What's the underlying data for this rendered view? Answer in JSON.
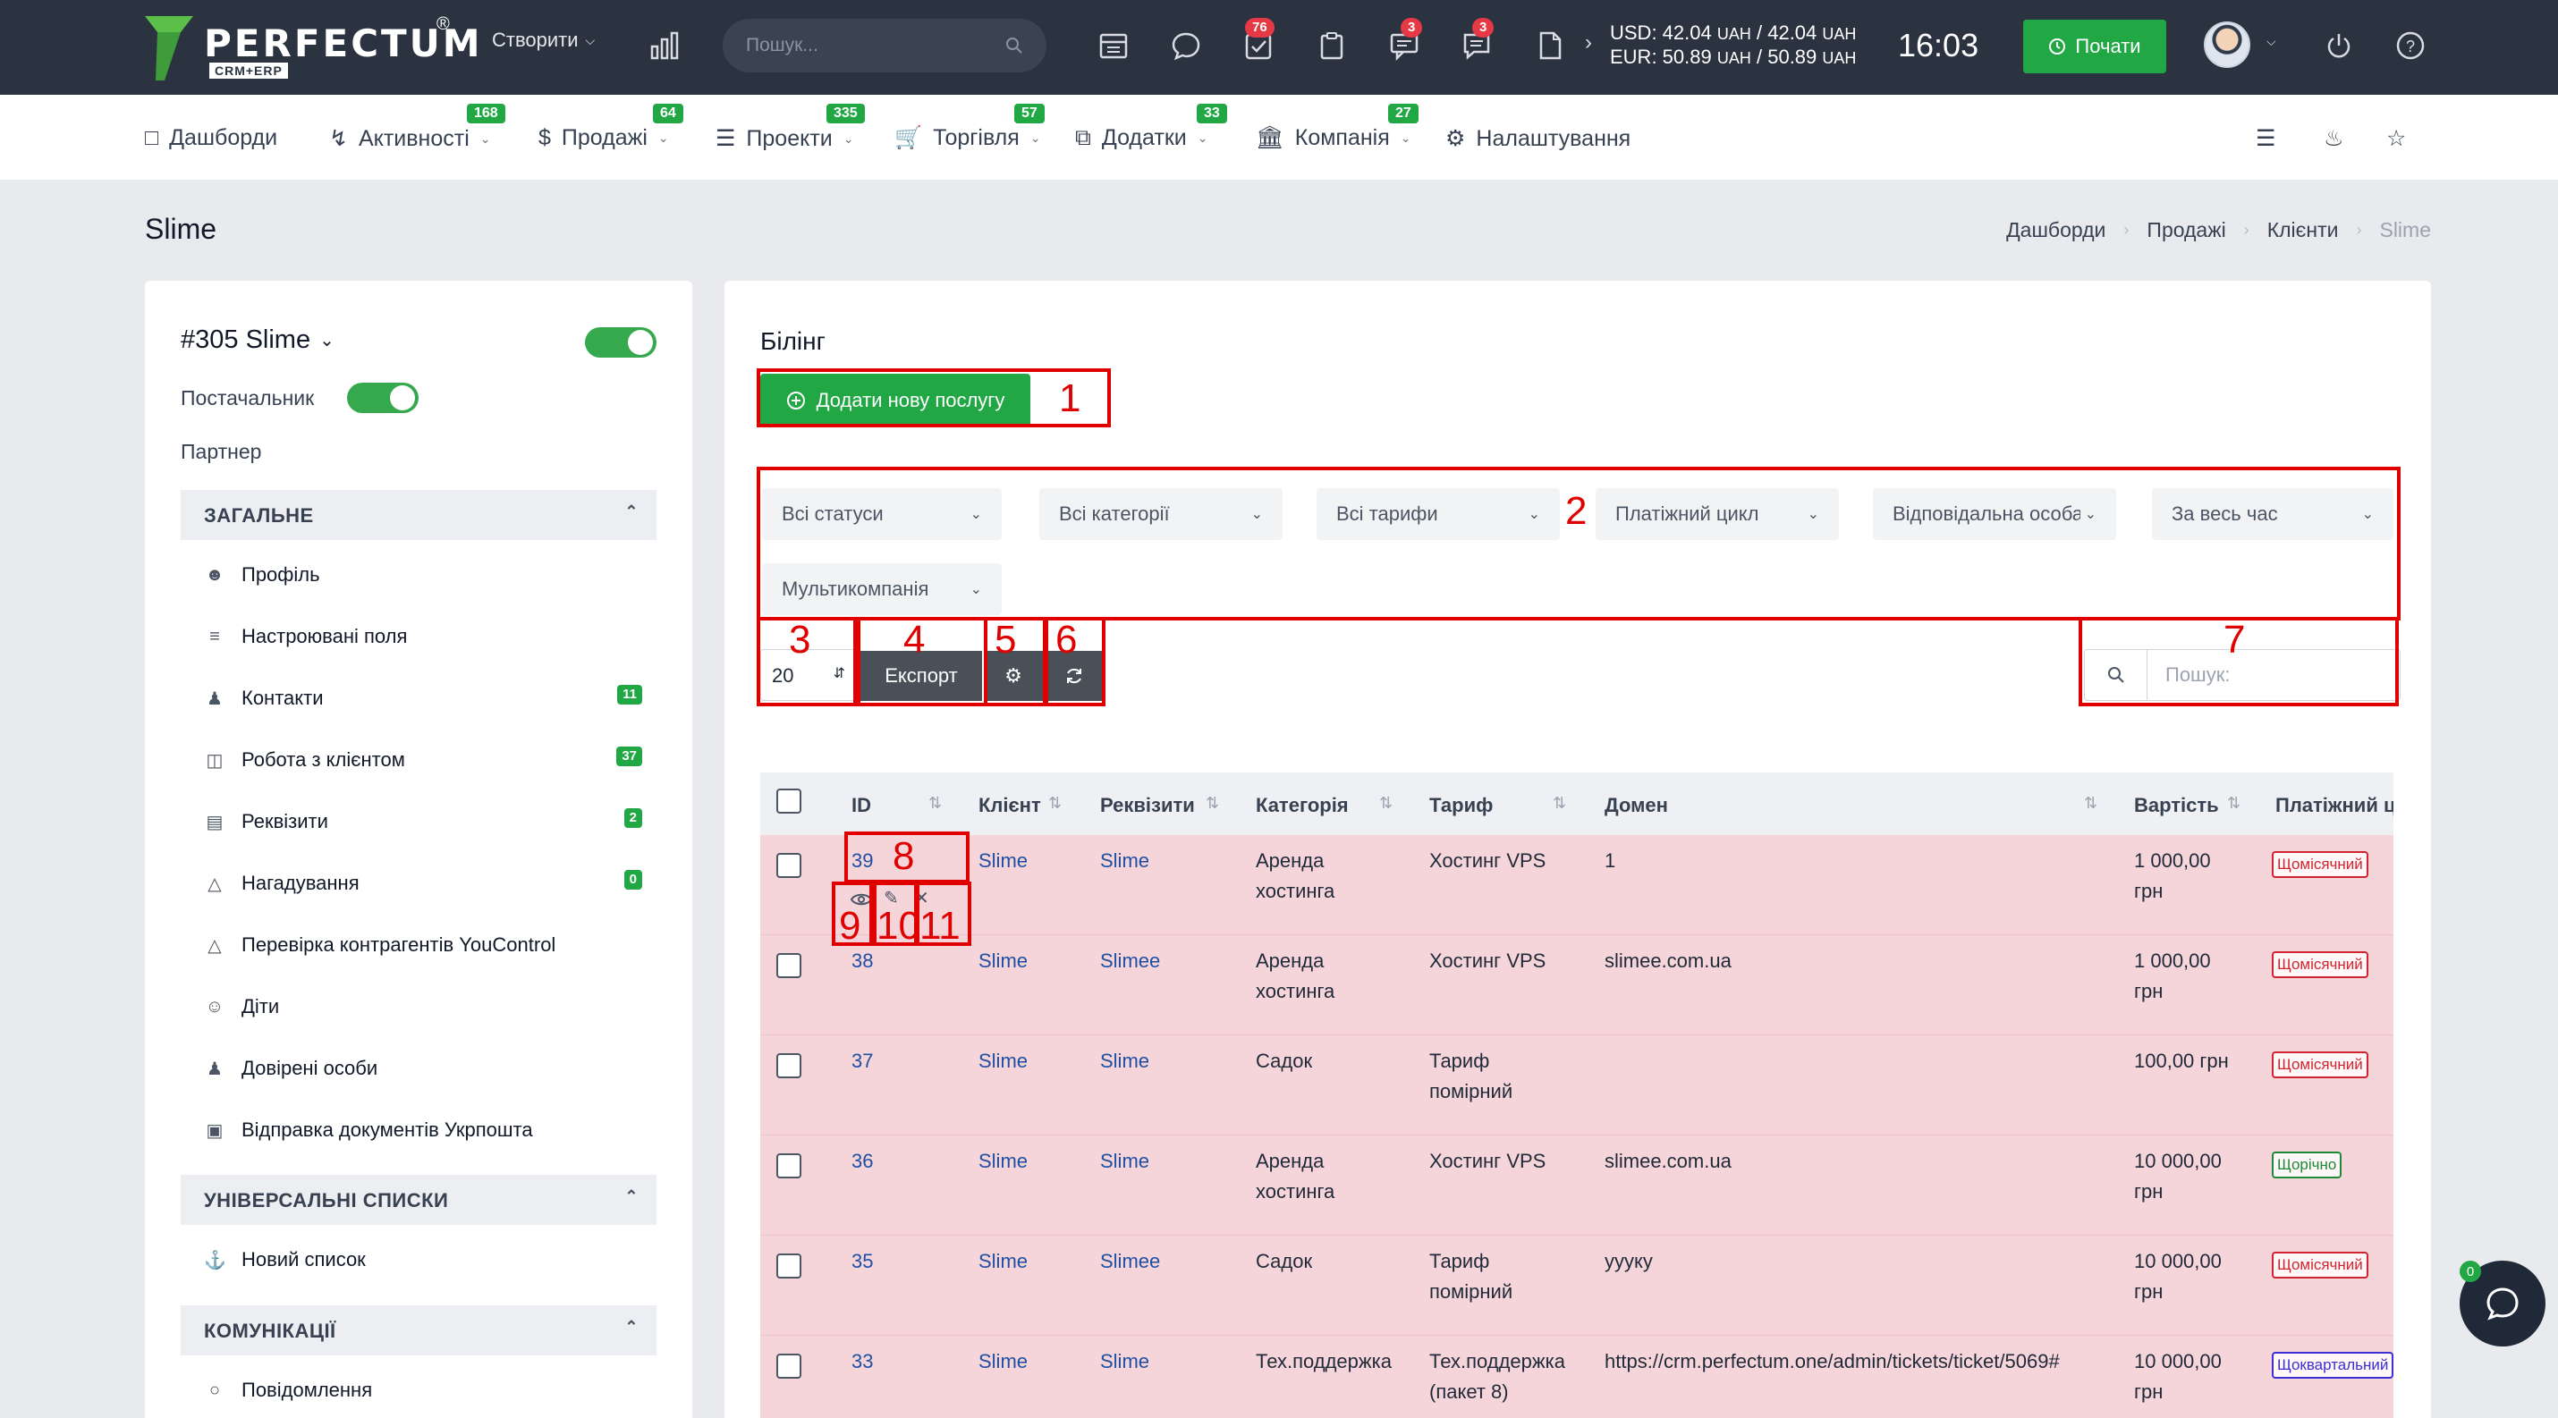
{
  "topbar": {
    "brand": "PERFECTUM",
    "brand_reg": "®",
    "brand_sub": "CRM+ERP",
    "create_label": "Створити",
    "search_placeholder": "Пошук...",
    "badges": {
      "tasks": "76",
      "chat": "3",
      "messages": "3"
    },
    "usd": "USD: 42.04",
    "usd_unit1": "UAH",
    "usd_sep": "/ 42.04",
    "usd_unit2": "UAH",
    "eur": "EUR: 50.89",
    "eur_unit1": "UAH",
    "eur_sep": "/ 50.89",
    "eur_unit2": "UAH",
    "clock": "16:03",
    "start_label": "Почати"
  },
  "nav": [
    {
      "label": "Дашборди",
      "icon": "monitor-icon"
    },
    {
      "label": "Активності",
      "badge": "168",
      "icon": "bolt-icon"
    },
    {
      "label": "Продажі",
      "badge": "64",
      "icon": "dollar-icon"
    },
    {
      "label": "Проекти",
      "badge": "335",
      "icon": "layers-icon"
    },
    {
      "label": "Торгівля",
      "badge": "57",
      "icon": "cart-icon"
    },
    {
      "label": "Додатки",
      "badge": "33",
      "icon": "copy-icon"
    },
    {
      "label": "Компанія",
      "badge": "27",
      "icon": "building-icon"
    },
    {
      "label": "Налаштування",
      "icon": "gear-icon"
    }
  ],
  "page": {
    "title": "Slime",
    "breadcrumb": [
      "Дашборди",
      "Продажі",
      "Клієнти",
      "Slime"
    ]
  },
  "sidebar": {
    "client": "#305 Slime",
    "supplier_label": "Постачальник",
    "partner_label": "Партнер",
    "sections": [
      {
        "title": "ЗАГАЛЬНЕ",
        "items": [
          {
            "label": "Профіль",
            "icon": "user-icon"
          },
          {
            "label": "Настроювані поля",
            "icon": "list-icon"
          },
          {
            "label": "Контакти",
            "icon": "users-icon",
            "badge": "11"
          },
          {
            "label": "Робота з клієнтом",
            "icon": "clipboard-icon",
            "badge": "37"
          },
          {
            "label": "Реквізити",
            "icon": "id-card-icon",
            "badge": "2"
          },
          {
            "label": "Нагадування",
            "icon": "bell-icon",
            "badge": "0"
          },
          {
            "label": "Перевірка контрагентів YouControl",
            "icon": "bell-icon"
          },
          {
            "label": "Діти",
            "icon": "child-icon"
          },
          {
            "label": "Довірені особи",
            "icon": "people-icon"
          },
          {
            "label": "Відправка документів Укрпошта",
            "icon": "boxes-icon"
          }
        ]
      },
      {
        "title": "УНІВЕРСАЛЬНІ СПИСКИ",
        "items": [
          {
            "label": "Новий список",
            "icon": "anchor-icon"
          }
        ]
      },
      {
        "title": "КОМУНІКАЦІЇ",
        "items": [
          {
            "label": "Повідомлення",
            "icon": "chat-icon"
          }
        ]
      }
    ]
  },
  "billing": {
    "title": "Білінг",
    "add_label": "Додати нову послугу",
    "filters": [
      "Всі статуси",
      "Всі категорії",
      "Всі тарифи",
      "Платіжний цикл",
      "Відповідальна особа",
      "За весь час",
      "Мультикомпанія"
    ],
    "per_page": "20",
    "export_label": "Експорт",
    "search_placeholder": "Пошук:",
    "annotations": [
      "1",
      "2",
      "3",
      "4",
      "5",
      "6",
      "7",
      "8",
      "9",
      "10",
      "11"
    ],
    "columns": [
      "ID",
      "Клієнт",
      "Реквізити",
      "Категорія",
      "Тариф",
      "Домен",
      "Вартість",
      "Платіжний цикл"
    ],
    "rows": [
      {
        "id": "39",
        "client": "Slime",
        "req": "Slime",
        "cat1": "Аренда",
        "cat2": "хостинга",
        "tariff1": "Хостинг VPS",
        "tariff2": "",
        "domain": "1",
        "price1": "1 000,00",
        "price2": "грн",
        "cycle": "Щомісячний",
        "cycle_color": "red"
      },
      {
        "id": "38",
        "client": "Slime",
        "req": "Slimee",
        "cat1": "Аренда",
        "cat2": "хостинга",
        "tariff1": "Хостинг VPS",
        "tariff2": "",
        "domain": "slimee.com.ua",
        "price1": "1 000,00",
        "price2": "грн",
        "cycle": "Щомісячний",
        "cycle_color": "red"
      },
      {
        "id": "37",
        "client": "Slime",
        "req": "Slime",
        "cat1": "Садок",
        "cat2": "",
        "tariff1": "Тариф",
        "tariff2": "помірний",
        "domain": "",
        "price1": "100,00 грн",
        "price2": "",
        "cycle": "Щомісячний",
        "cycle_color": "red"
      },
      {
        "id": "36",
        "client": "Slime",
        "req": "Slime",
        "cat1": "Аренда",
        "cat2": "хостинга",
        "tariff1": "Хостинг VPS",
        "tariff2": "",
        "domain": "slimee.com.ua",
        "price1": "10 000,00",
        "price2": "грн",
        "cycle": "Щорічно",
        "cycle_color": "green"
      },
      {
        "id": "35",
        "client": "Slime",
        "req": "Slimee",
        "cat1": "Садок",
        "cat2": "",
        "tariff1": "Тариф",
        "tariff2": "помірний",
        "domain": "ууyку",
        "price1": "10 000,00",
        "price2": "грн",
        "cycle": "Щомісячний",
        "cycle_color": "red"
      },
      {
        "id": "33",
        "client": "Slime",
        "req": "Slime",
        "cat1": "Тех.поддержка",
        "cat2": "",
        "tariff1": "Тех.поддержка",
        "tariff2": "(пакет 8)",
        "domain": "https://crm.perfectum.one/admin/tickets/ticket/5069#",
        "price1": "10 000,00",
        "price2": "грн",
        "cycle": "Щоквартальний",
        "cycle_color": "blue"
      }
    ]
  },
  "chat_widget": {
    "badge": "0"
  }
}
